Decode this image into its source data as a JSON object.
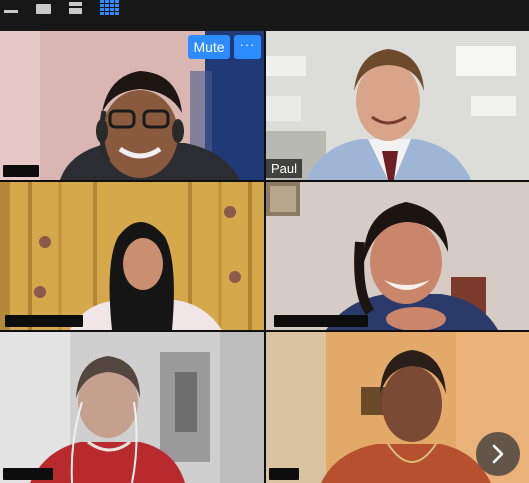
{
  "toolbar": {
    "view_buttons": [
      {
        "icon": "minimize-icon"
      },
      {
        "icon": "speaker-view-icon"
      },
      {
        "icon": "filmstrip-view-icon"
      },
      {
        "icon": "gallery-view-icon",
        "active": true
      }
    ],
    "accent_color": "#2d8cff"
  },
  "participants": [
    {
      "name": "",
      "name_redacted": true,
      "active": false
    },
    {
      "name": "Paul",
      "name_redacted": false,
      "active": false
    },
    {
      "name": "",
      "name_redacted": true,
      "active": false
    },
    {
      "name": "",
      "name_redacted": true,
      "active": false
    },
    {
      "name": "",
      "name_redacted": true,
      "active": true
    },
    {
      "name": "",
      "name_redacted": true,
      "active": false
    }
  ],
  "hover_controls": {
    "mute_label": "Mute",
    "more_label": "···"
  },
  "pagination": {
    "next_icon": "chevron-right-icon"
  },
  "colors": {
    "active_speaker_border": "#b5d334",
    "button_blue": "#2d8cff"
  }
}
